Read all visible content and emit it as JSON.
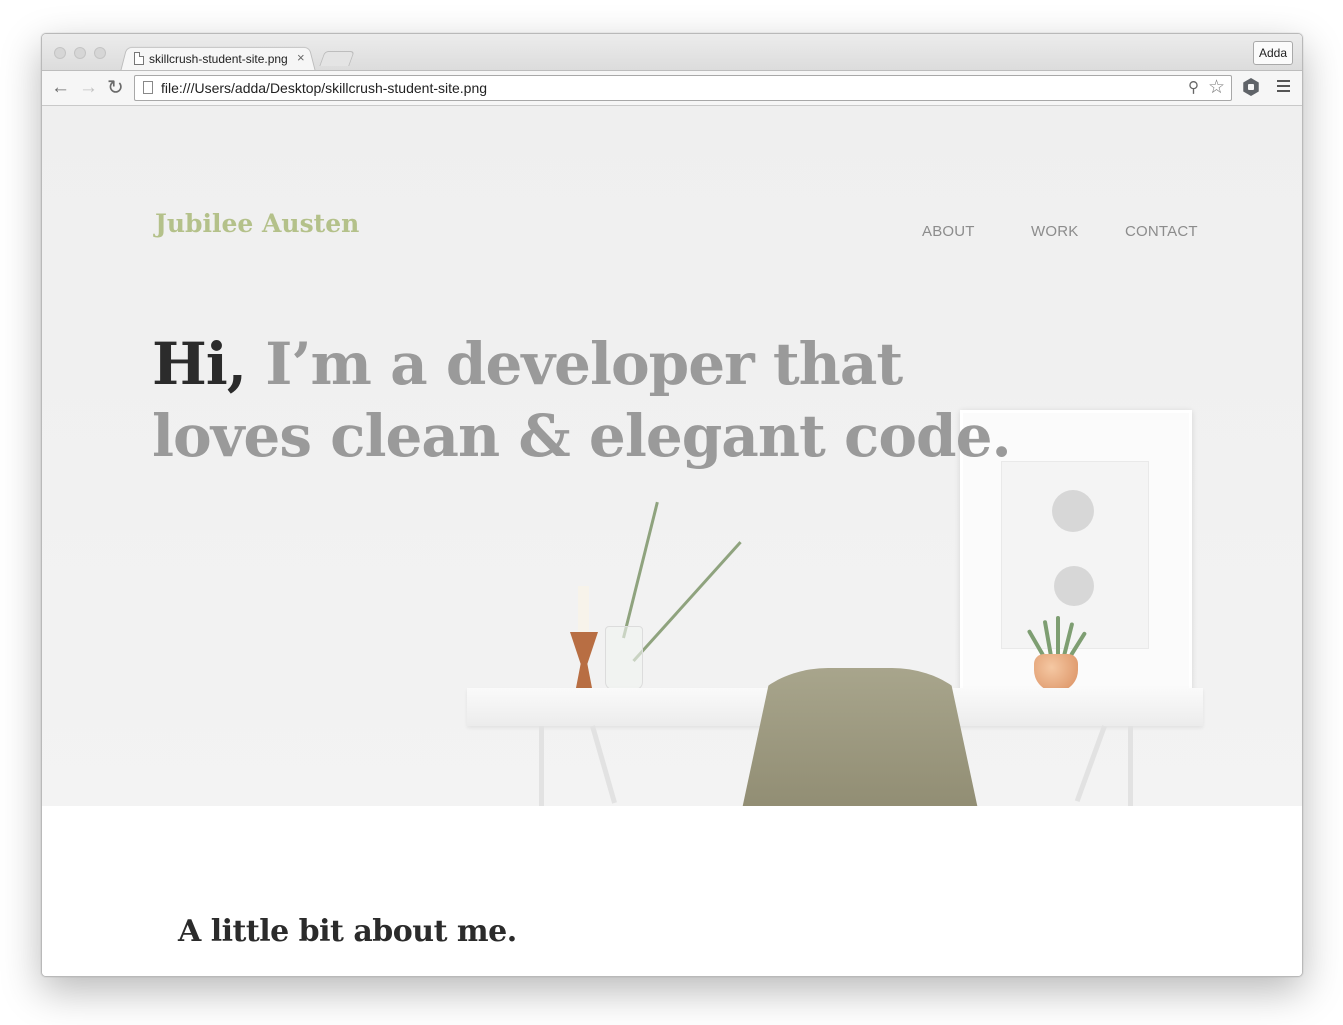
{
  "browser": {
    "tab_title": "skillcrush-student-site.png",
    "tab_close": "×",
    "profile_name": "Adda",
    "url": "file:///Users/adda/Desktop/skillcrush-student-site.png",
    "icons": {
      "back": "arrow-left-icon",
      "forward": "arrow-right-icon",
      "reload": "reload-icon",
      "zoom": "magnifier-icon",
      "bookmark": "star-icon",
      "extension": "extension-icon",
      "menu": "hamburger-menu-icon"
    }
  },
  "site": {
    "logo": "Jubilee Austen",
    "nav": [
      "ABOUT",
      "WORK",
      "CONTACT"
    ],
    "headline_hi": "Hi,",
    "headline_rest": " I’m a developer that loves clean & elegant code.",
    "about_heading": "A little bit about me."
  },
  "colors": {
    "logo": "#b4c18a",
    "nav": "#8c8c8c",
    "headline_dark": "#2b2b2b",
    "headline_light": "#9a9a9a",
    "hero_bg": "#efefef"
  }
}
